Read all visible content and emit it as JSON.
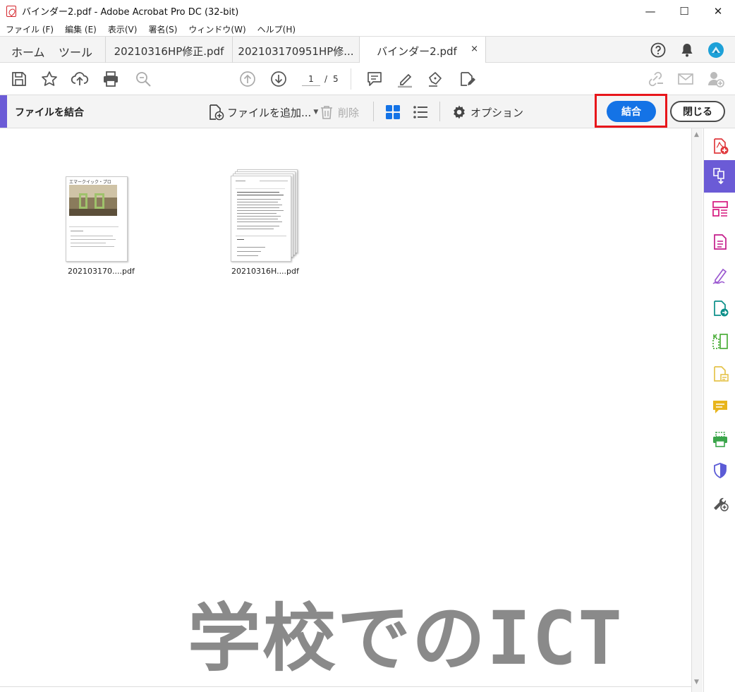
{
  "window": {
    "title": "バインダー2.pdf - Adobe Acrobat Pro DC (32-bit)",
    "minimize": "—",
    "maximize": "☐",
    "close": "✕"
  },
  "menu": {
    "items": [
      "ファイル (F)",
      "編集 (E)",
      "表示(V)",
      "署名(S)",
      "ウィンドウ(W)",
      "ヘルプ(H)"
    ]
  },
  "tabs": {
    "home": "ホーム",
    "tools": "ツール",
    "documents": [
      {
        "label": "20210316HP修正.pdf"
      },
      {
        "label": "20210317095​1HP修..."
      },
      {
        "label": "バインダー2.pdf",
        "close": "×"
      }
    ]
  },
  "toolbar": {
    "current_page": "1",
    "separator": "/",
    "total_pages": "5"
  },
  "combine": {
    "title": "ファイルを結合",
    "add_files": "ファイルを追加...",
    "delete": "削除",
    "options": "オプション",
    "combine_button": "結合",
    "close_button": "閉じる"
  },
  "files": [
    {
      "name": "202103170....pdf",
      "pages": 1,
      "header": "エマークイック・プロ"
    },
    {
      "name": "20210316H....pdf",
      "pages": 4
    }
  ],
  "watermark": "学校でのICT",
  "colors": {
    "accent_purple": "#6b5bd6",
    "primary_blue": "#1473e6",
    "highlight_red": "#e8161b"
  },
  "right_panel_icons": [
    "create-pdf-icon",
    "combine-files-icon",
    "organize-pages-icon",
    "export-pdf-icon",
    "fill-sign-icon",
    "send-for-review-icon",
    "compare-icon",
    "edit-pdf-icon",
    "comment-icon",
    "print-production-icon",
    "protect-icon",
    "more-tools-icon"
  ]
}
